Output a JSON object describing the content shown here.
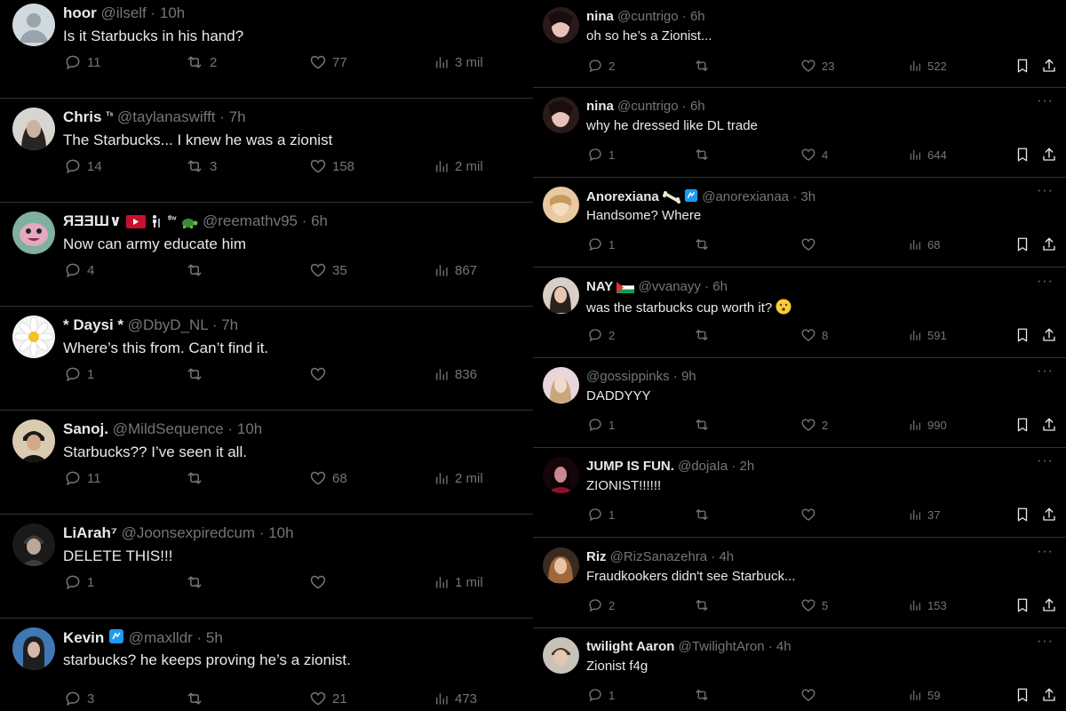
{
  "left_tweets": [
    {
      "name": "hoor",
      "handle": "@ilself",
      "time": "· 10h",
      "text": "Is it Starbucks in his hand?",
      "replies": "11",
      "reposts": "2",
      "likes": "77",
      "views": "3 mil",
      "avatar": "default-avatar"
    },
    {
      "name": "Chris",
      "name_suffix": "ᵀˢ",
      "handle": "@taylanaswifft",
      "time": "· 7h",
      "text": "The Starbucks... I knew he was a zionist",
      "replies": "14",
      "reposts": "3",
      "likes": "158",
      "views": "2 mil",
      "avatar": "photo-avatar"
    },
    {
      "name": "ЯƎƎШ∨",
      "name_suffix": "ᵗʰᵛ",
      "handle": "@reemathv95",
      "time": "· 6h",
      "text": "Now can army educate him",
      "replies": "4",
      "reposts": "",
      "likes": "35",
      "views": "867",
      "avatar": "cartoon-avatar"
    },
    {
      "name": "* Daysi *",
      "handle": "@DbyD_NL",
      "time": "· 7h",
      "text": "Where’s this from. Can’t find it.",
      "replies": "1",
      "reposts": "",
      "likes": "",
      "views": "836",
      "avatar": "daisy-avatar"
    },
    {
      "name": "Sanoj.",
      "handle": "@MildSequence",
      "time": "· 10h",
      "text": "Starbucks?? I’ve seen it all.",
      "replies": "11",
      "reposts": "",
      "likes": "68",
      "views": "2 mil",
      "avatar": "photo-avatar"
    },
    {
      "name": "LiArah⁷",
      "handle": "@Joonsexpiredcum",
      "time": "· 10h",
      "text": "DELETE THIS!!!",
      "replies": "1",
      "reposts": "",
      "likes": "",
      "views": "1 mil",
      "avatar": "photo-avatar"
    },
    {
      "name": "Kevin",
      "handle": "@maxlldr",
      "time": "· 5h",
      "text": "starbucks? he keeps proving he’s a zionist.",
      "replies": "3",
      "reposts": "",
      "likes": "21",
      "views": "473",
      "avatar": "photo-avatar"
    }
  ],
  "right_tweets": [
    {
      "name": "nina",
      "handle": "@cuntrigo",
      "time": "· 6h",
      "text": "oh so he’s a Zionist...",
      "replies": "2",
      "reposts": "",
      "likes": "23",
      "views": "522",
      "more": "",
      "avatar": "photo-avatar"
    },
    {
      "name": "nina",
      "handle": "@cuntrigo",
      "time": "· 6h",
      "text": "why he dressed like DL trade",
      "replies": "1",
      "reposts": "",
      "likes": "4",
      "views": "644",
      "more": "···",
      "avatar": "photo-avatar"
    },
    {
      "name": "Anorexiana",
      "handle": "@anorexianaa",
      "time": "· 3h",
      "text": "Handsome? Where",
      "replies": "1",
      "reposts": "",
      "likes": "",
      "views": "68",
      "more": "···",
      "avatar": "photo-avatar"
    },
    {
      "name": "NAY",
      "handle": "@vvanayy",
      "time": "· 6h",
      "text": "was the starbucks cup worth it?",
      "replies": "2",
      "reposts": "",
      "likes": "8",
      "views": "591",
      "more": "···",
      "avatar": "photo-avatar"
    },
    {
      "name": "",
      "handle": "@gossippinks",
      "time": "· 9h",
      "text": "DADDYYY",
      "replies": "1",
      "reposts": "",
      "likes": "2",
      "views": "990",
      "more": "···",
      "avatar": "photo-avatar"
    },
    {
      "name": "JUMP IS FUN.",
      "handle": "@dojaIa",
      "time": "· 2h",
      "text": "ZIONIST!!!!!!",
      "replies": "1",
      "reposts": "",
      "likes": "",
      "views": "37",
      "more": "···",
      "avatar": "photo-avatar"
    },
    {
      "name": "Riz",
      "handle": "@RizSanazehra",
      "time": "· 4h",
      "text": "Fraudkookers didn't see Starbuck...",
      "replies": "2",
      "reposts": "",
      "likes": "5",
      "views": "153",
      "more": "···",
      "avatar": "photo-avatar"
    },
    {
      "name": "twilight Aaron",
      "handle": "@TwilightAron",
      "time": "· 4h",
      "text": "Zionist f4g",
      "replies": "1",
      "reposts": "",
      "likes": "",
      "views": "59",
      "more": "···",
      "avatar": "photo-avatar"
    }
  ],
  "colors": {
    "background": "#000000",
    "text": "#e7e9ea",
    "muted": "#71767b",
    "divider": "#2f3336",
    "verified": "#1d9bf0"
  }
}
